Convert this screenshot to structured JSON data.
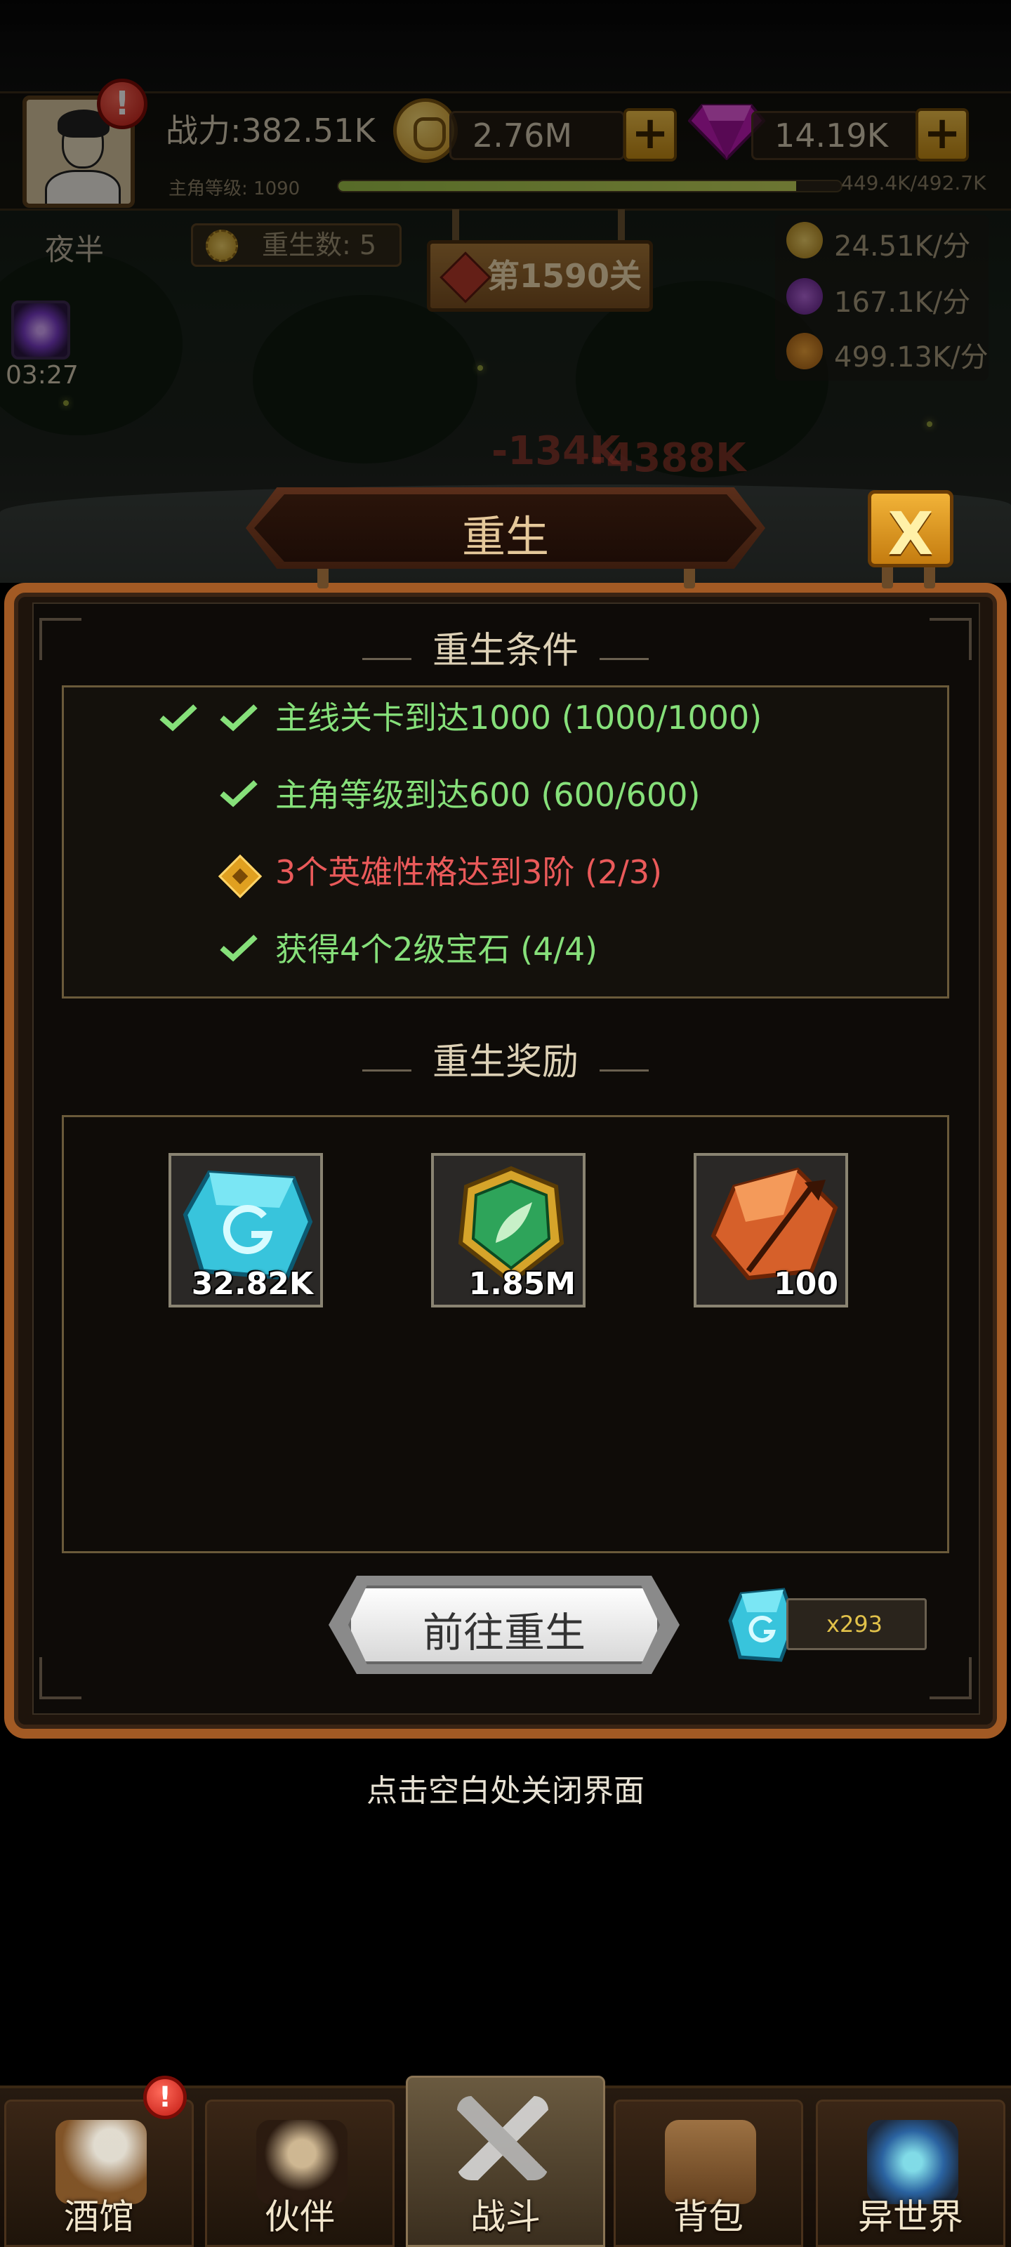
{
  "hud": {
    "power": "战力:382.51K",
    "gold": "2.76M",
    "diamonds": "14.19K",
    "level_label": "主角等级: 1090",
    "level_progress": "449.4K/492.7K",
    "level_fraction": 0.91,
    "time_of_day": "夜半",
    "rebirth_count": "重生数: 5",
    "stage": "第1590关",
    "rate_gold": "24.51K/分",
    "rate_exp": "167.1K/分",
    "rate_fire": "499.13K/分",
    "buff_timer": "03:27",
    "alert_mark": "!"
  },
  "modal": {
    "title": "重生",
    "close_label": "X",
    "conditions_title": "重生条件",
    "conditions": [
      {
        "text": "主线关卡到达1000 (1000/1000)",
        "status": "done"
      },
      {
        "text": "主角等级到达600 (600/600)",
        "status": "done"
      },
      {
        "text": "3个英雄性格达到3阶 (2/3)",
        "status": "pending"
      },
      {
        "text": "获得4个2级宝石 (4/4)",
        "status": "done"
      }
    ],
    "rewards_title": "重生奖励",
    "rewards": [
      {
        "icon": "blue-crystal-icon",
        "qty": "32.82K"
      },
      {
        "icon": "green-emblem-icon",
        "qty": "1.85M"
      },
      {
        "icon": "orange-crystal-icon",
        "qty": "100"
      }
    ],
    "go_button": "前往重生",
    "cost": "x293",
    "close_hint": "点击空白处关闭界面"
  },
  "nav": {
    "tabs": [
      {
        "label": "酒馆",
        "icon": "tavern-mug-icon"
      },
      {
        "label": "伙伴",
        "icon": "partner-icon"
      },
      {
        "label": "战斗",
        "icon": "crossed-swords-icon"
      },
      {
        "label": "背包",
        "icon": "backpack-icon"
      },
      {
        "label": "异世界",
        "icon": "portal-icon"
      }
    ],
    "active": "战斗"
  },
  "colors": {
    "ok": "#86e07a",
    "warn": "#ea5a5a",
    "panel_border": "#a25a24",
    "gold_button": "#f2b338"
  }
}
